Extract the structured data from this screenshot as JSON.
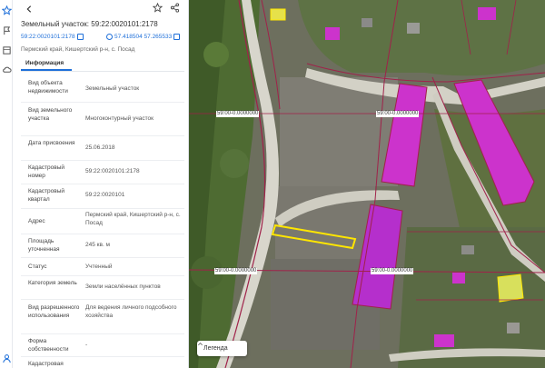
{
  "header": {
    "title": "Земельный участок: 59:22:0020101:2178",
    "cad_link": "59:22:0020101:2178",
    "coords": "57.418504 57.265533",
    "address": "Пермский край, Кишертский р-н, с. Посад"
  },
  "tabs": [
    {
      "label": "Информация",
      "active": true
    }
  ],
  "info_rows": [
    {
      "key": "Вид объекта недвижимости",
      "value": "Земельный участок"
    },
    {
      "key": "Вид земельного участка",
      "value": "Многоконтурный участок"
    },
    {
      "key": "Дата присвоения",
      "value": "25.06.2018"
    },
    {
      "key": "Кадастровый номер",
      "value": "59:22:0020101:2178"
    },
    {
      "key": "Кадастровый квартал",
      "value": "59:22:0020101"
    },
    {
      "key": "Адрес",
      "value": "Пермский край, Кишертский р-н, с. Посад"
    },
    {
      "key": "Площадь уточненная",
      "value": "245 кв. м"
    },
    {
      "key": "Статус",
      "value": "Учтенный"
    },
    {
      "key": "Категория земель",
      "value": "Земли населённых пунктов"
    },
    {
      "key": "Вид разрешенного использования",
      "value": "Для ведения личного подсобного хозяйства"
    },
    {
      "key": "Форма собственности",
      "value": "-"
    },
    {
      "key": "Кадастровая",
      "value": ""
    }
  ],
  "map": {
    "zone_labels": [
      "59:00-0.0000000",
      "59:00-0.0000000",
      "59:00-0.0000000",
      "59:00-0.0000000"
    ],
    "legend_label": "Легенда"
  },
  "colors": {
    "accent": "#1e6fd9",
    "parcel_highlight": "#ffe600",
    "building": "#cc33cc",
    "boundary": "#a0224a"
  },
  "icons": {
    "rail": [
      "star-icon",
      "pin-icon",
      "layers-icon",
      "cloud-icon",
      "user-icon"
    ],
    "toolbar": [
      "back-arrow-icon",
      "favorite-star-icon",
      "share-icon"
    ]
  }
}
